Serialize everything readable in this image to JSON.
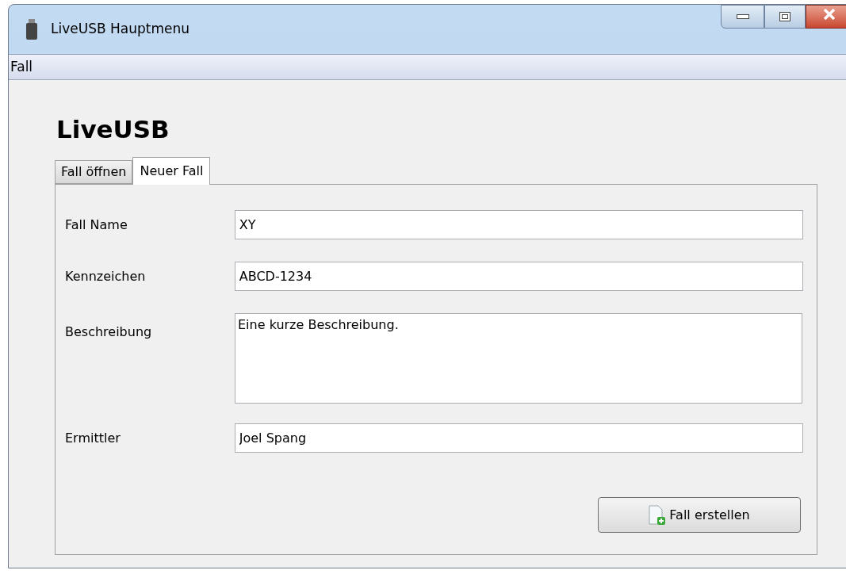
{
  "window": {
    "title": "LiveUSB Hauptmenu"
  },
  "menu": [
    "Fall"
  ],
  "heading": "LiveUSB",
  "tabs": [
    {
      "label": "Fall öffnen",
      "selected": false
    },
    {
      "label": "Neuer Fall",
      "selected": true
    }
  ],
  "fields": [
    {
      "kind": "line",
      "label": "Fall Name",
      "value": "XY"
    },
    {
      "kind": "line",
      "label": "Kennzeichen",
      "value": "ABCD-1234"
    },
    {
      "kind": "multiline",
      "label": "Beschreibung",
      "value": "Eine kurze Beschreibung."
    },
    {
      "kind": "line",
      "label": "Ermittler",
      "value": "Joel Spang"
    }
  ],
  "button": {
    "label": "Fall erstellen"
  }
}
